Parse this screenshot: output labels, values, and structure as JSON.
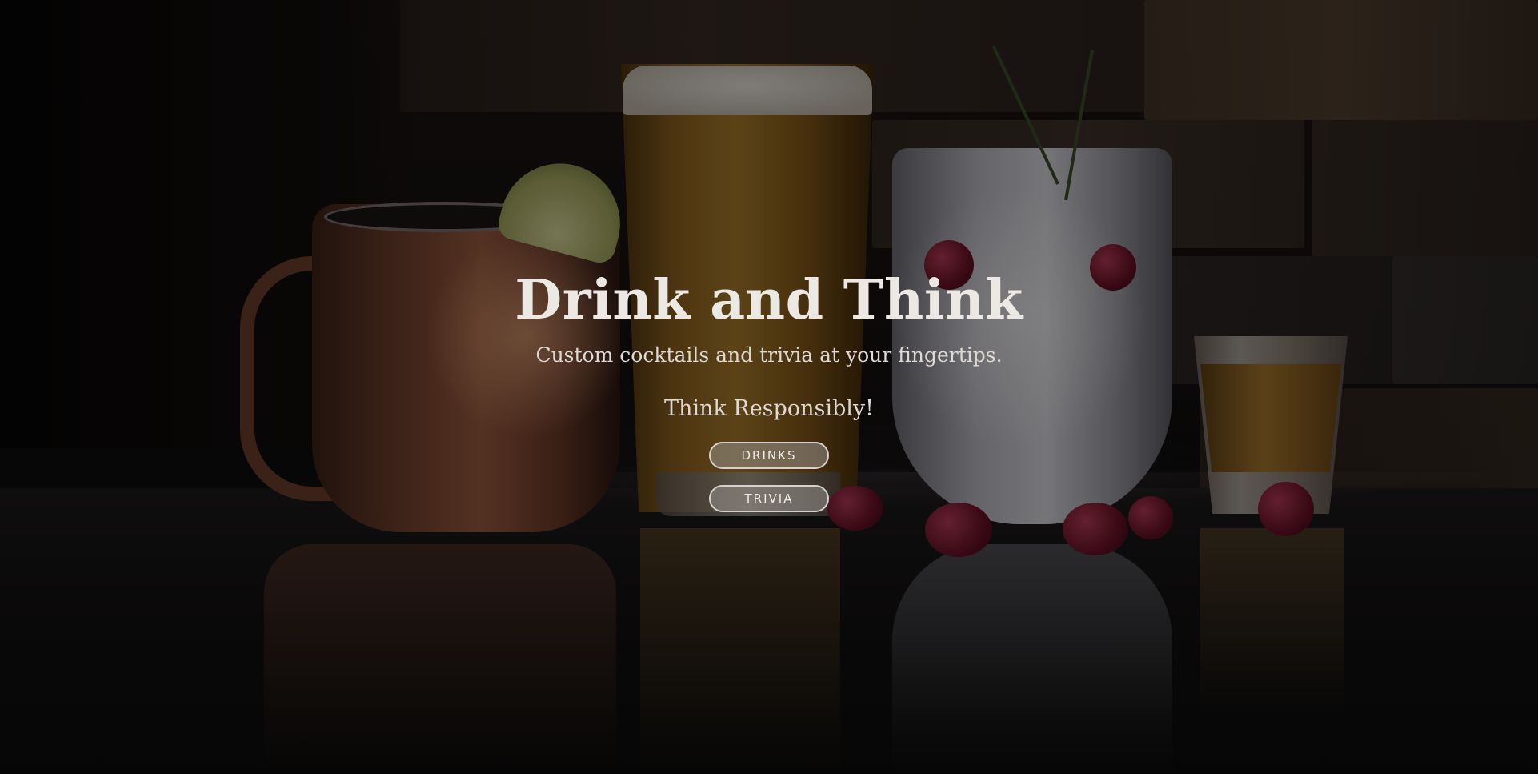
{
  "hero": {
    "title": "Drink and Think",
    "subtitle": "Custom cocktails and trivia at your fingertips.",
    "tagline": "Think Responsibly!"
  },
  "buttons": {
    "drinks_label": "DRINKS",
    "trivia_label": "TRIVIA"
  },
  "background": {
    "description_icon": "bar-drinks-photo",
    "overlay_color": "#000000"
  }
}
